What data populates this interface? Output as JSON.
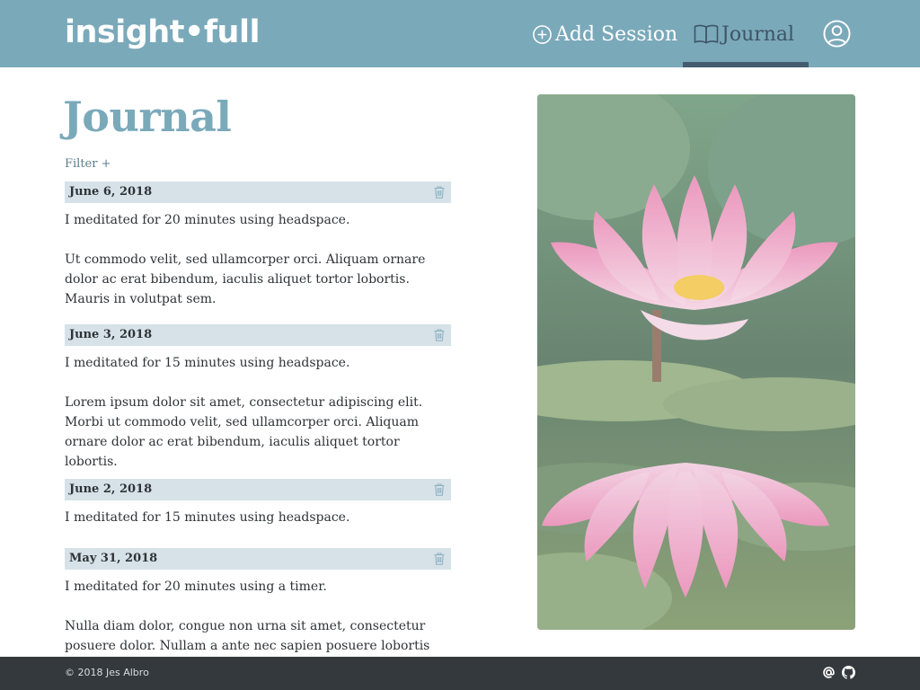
{
  "header": {
    "logo": "insight•full",
    "nav": {
      "add_session": "Add Session",
      "journal": "Journal"
    }
  },
  "main": {
    "title": "Journal",
    "filter_label": "Filter +",
    "entries": [
      {
        "date": "June 6, 2018",
        "summary": "I meditated for 20 minutes using headspace.",
        "notes": "Ut commodo velit, sed ullamcorper orci. Aliquam ornare dolor ac erat bibendum, iaculis aliquet tortor lobortis. Mauris in volutpat sem."
      },
      {
        "date": "June 3, 2018",
        "summary": "I meditated for 15 minutes using headspace.",
        "notes": "Lorem ipsum dolor sit amet, consectetur adipiscing elit. Morbi ut commodo velit, sed ullamcorper orci. Aliquam ornare dolor ac erat bibendum, iaculis aliquet tortor lobortis."
      },
      {
        "date": "June 2, 2018",
        "summary": "I meditated for 15 minutes using headspace.",
        "notes": ""
      },
      {
        "date": "May 31, 2018",
        "summary": "I meditated for 20 minutes using a timer.",
        "notes": "Nulla diam dolor, congue non urna sit amet, consectetur posuere dolor. Nullam a ante nec sapien posuere lobortis vitae"
      }
    ]
  },
  "footer": {
    "copyright": "© 2018 Jes Albro"
  },
  "colors": {
    "header_bg": "#7aa9ba",
    "nav_active": "#445d6e",
    "entry_bar": "#d6e2e8",
    "footer_bg": "#33393d"
  },
  "icons": [
    "plus-circle-icon",
    "book-icon",
    "user-circle-icon",
    "trash-icon",
    "email-icon",
    "github-icon"
  ]
}
